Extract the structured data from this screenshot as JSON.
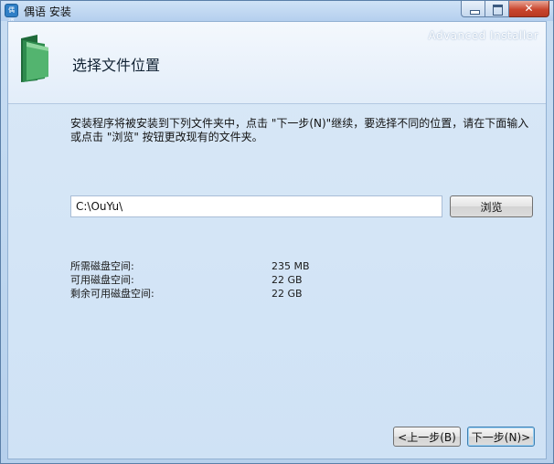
{
  "window": {
    "title": "偶语 安装",
    "app_icon_text": "偶语"
  },
  "header": {
    "brand": "Advanced Installer",
    "step_title": "选择文件位置"
  },
  "main": {
    "description": "安装程序将被安装到下列文件夹中，点击 \"下一步(N)\"继续，要选择不同的位置，请在下面输入或点击 \"浏览\" 按钮更改现有的文件夹。",
    "path_value": "C:\\OuYu\\",
    "browse_label": "浏览",
    "space": [
      {
        "label": "所需磁盘空间:",
        "value": "235 MB"
      },
      {
        "label": "可用磁盘空间:",
        "value": "22 GB"
      },
      {
        "label": "剩余可用磁盘空间:",
        "value": "22 GB"
      }
    ]
  },
  "footer": {
    "back_label": "<上一步(B)",
    "next_label": "下一步(N)>"
  },
  "colors": {
    "folder_green": "#2e8b4e",
    "close_red": "#c9462e"
  }
}
